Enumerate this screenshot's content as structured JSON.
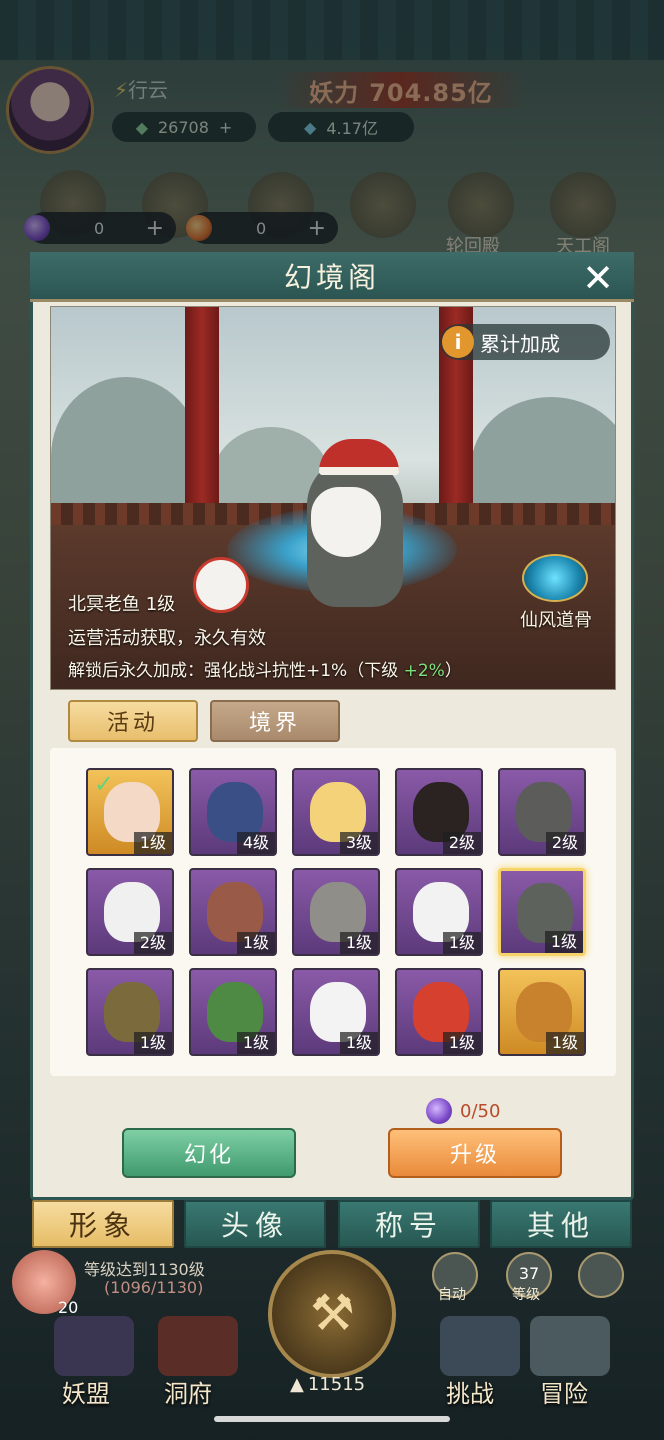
{
  "hud": {
    "player_name": "行云",
    "power_label": "妖力",
    "power_value": "704.85亿",
    "gold": "26708",
    "spirit": "4.17亿",
    "res1": "0",
    "res2": "0",
    "bg_icon_labels": [
      "轮回殿",
      "天工阁"
    ]
  },
  "panel": {
    "title": "幻境阁",
    "close_icon": "close-x-icon",
    "bonus_button": "累计加成",
    "character_name": "北冥老鱼 1级",
    "obtain_text": "运营活动获取，永久有效",
    "bonus_prefix": "解锁后永久加成：强化战斗抗性+1%（下级",
    "bonus_next": "+2%",
    "bonus_suffix": "）",
    "badge_label": "仙风道骨"
  },
  "tabs": [
    "活动",
    "境界"
  ],
  "skins": [
    {
      "level": "1级",
      "bg": "gold",
      "owned": true,
      "face": "#f3d9c6"
    },
    {
      "level": "4级",
      "bg": "purple",
      "owned": false,
      "face": "#3a4f86"
    },
    {
      "level": "3级",
      "bg": "purple",
      "owned": false,
      "face": "#f3d27a"
    },
    {
      "level": "2级",
      "bg": "purple",
      "owned": false,
      "face": "#2b2222"
    },
    {
      "level": "2级",
      "bg": "purple",
      "owned": false,
      "face": "#5c5d5a"
    },
    {
      "level": "2级",
      "bg": "purple",
      "owned": false,
      "face": "#f0f0f0"
    },
    {
      "level": "1级",
      "bg": "purple",
      "owned": false,
      "face": "#9a5a48"
    },
    {
      "level": "1级",
      "bg": "purple",
      "owned": false,
      "face": "#8f8e88"
    },
    {
      "level": "1级",
      "bg": "purple",
      "owned": false,
      "face": "#f2f2f2"
    },
    {
      "level": "1级",
      "bg": "purple",
      "owned": false,
      "face": "#5d625d",
      "selected": true
    },
    {
      "level": "1级",
      "bg": "purple",
      "owned": false,
      "face": "#7a6a3c"
    },
    {
      "level": "1级",
      "bg": "purple",
      "owned": false,
      "face": "#4f8a44"
    },
    {
      "level": "1级",
      "bg": "purple",
      "owned": false,
      "face": "#f3f3f3"
    },
    {
      "level": "1级",
      "bg": "purple",
      "owned": false,
      "face": "#d6402e"
    },
    {
      "level": "1级",
      "bg": "gold",
      "owned": false,
      "face": "#c8822e"
    }
  ],
  "cost": "0/50",
  "buttons": {
    "transform": "幻化",
    "upgrade": "升级"
  },
  "bottom_tabs": [
    "形象",
    "头像",
    "称号",
    "其他"
  ],
  "bottom_hud": {
    "level_goal": "等级达到1130级",
    "level_progress": "(1096/1130)",
    "peach_count": "20",
    "auto_label": "自动",
    "level_num": "37",
    "level_label": "等级",
    "nav_left1": "妖盟",
    "nav_left2": "洞府",
    "center_count": "11515",
    "nav_right1": "挑战",
    "nav_right2": "冒险"
  }
}
